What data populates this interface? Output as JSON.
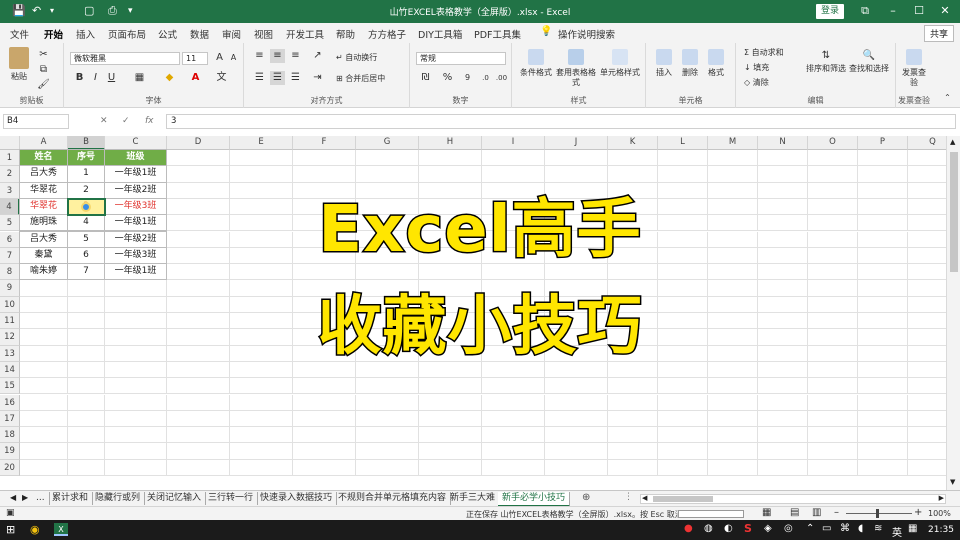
{
  "titlebar": {
    "title": "山竹EXCEL表格教学（全屏版）.xlsx - Excel",
    "login": "登录",
    "qa_icons": [
      "save-icon",
      "undo-icon",
      "new-file-icon",
      "print-preview-icon",
      "quick-access-dropdown-icon"
    ]
  },
  "menu": {
    "items": [
      "文件",
      "开始",
      "插入",
      "页面布局",
      "公式",
      "数据",
      "审阅",
      "视图",
      "开发工具",
      "帮助",
      "方方格子",
      "DIY工具箱",
      "PDF工具集",
      "操作说明搜索"
    ],
    "active": "开始",
    "share": "共享"
  },
  "ribbon": {
    "clipboard": {
      "paste": "粘贴",
      "label": "剪贴板"
    },
    "font": {
      "name": "微软雅黑",
      "size": "11",
      "label": "字体"
    },
    "alignment": {
      "wrap": "自动换行",
      "merge": "合并后居中",
      "label": "对齐方式"
    },
    "number": {
      "format": "常规",
      "label": "数字"
    },
    "styles": {
      "conditional": "条件格式",
      "table": "套用表格格式",
      "cell": "单元格样式",
      "label": "样式"
    },
    "cells": {
      "insert": "插入",
      "delete": "删除",
      "format": "格式",
      "label": "单元格"
    },
    "editing": {
      "autosum": "自动求和",
      "fill": "填充",
      "clear": "清除",
      "sort": "排序和筛选",
      "find": "查找和选择",
      "label": "编辑"
    },
    "invoice": {
      "check": "发票查验",
      "label": "发票查验"
    }
  },
  "formula": {
    "name_box": "B4",
    "cancel": "✕",
    "confirm": "✓",
    "fx": "fx",
    "value": "3"
  },
  "columns": [
    "A",
    "B",
    "C",
    "D",
    "E",
    "F",
    "G",
    "H",
    "I",
    "J",
    "K",
    "L",
    "M",
    "N",
    "O",
    "P",
    "Q"
  ],
  "rows": [
    "1",
    "2",
    "3",
    "4",
    "5",
    "6",
    "7",
    "8",
    "9",
    "10",
    "11",
    "12",
    "13",
    "14",
    "15",
    "16",
    "17",
    "18",
    "19",
    "20"
  ],
  "table": {
    "headers": [
      "姓名",
      "序号",
      "班级"
    ],
    "rows": [
      [
        "吕大秀",
        "1",
        "一年级1班"
      ],
      [
        "华翠花",
        "2",
        "一年级2班"
      ],
      [
        "华翠花",
        "3",
        "一年级3班"
      ],
      [
        "施明珠",
        "4",
        "一年级1班"
      ],
      [
        "吕大秀",
        "5",
        "一年级2班"
      ],
      [
        "秦黛",
        "6",
        "一年级3班"
      ],
      [
        "喻朱婷",
        "7",
        "一年级1班"
      ]
    ],
    "highlight_color": "#e0322d",
    "header_color": "#70ad47"
  },
  "overlay": {
    "line1": "Excel高手",
    "line2": "收藏小技巧"
  },
  "sheet_tabs": [
    "...",
    "累计求和",
    "隐藏行或列",
    "关闭记忆输入",
    "三行转一行",
    "快速录入数据技巧",
    "不规则合并单元格填充内容",
    "新手三大难",
    "新手必学小技巧"
  ],
  "active_tab": "新手必学小技巧",
  "status": {
    "text": "正在保存 山竹EXCEL表格教学（全屏版）.xlsx。按 Esc 取消。",
    "zoom": "100%"
  },
  "taskbar": {
    "ime": "英",
    "time": "21:35"
  },
  "colors": {
    "excel_green": "#217346",
    "overlay_text": "#ffe600"
  }
}
